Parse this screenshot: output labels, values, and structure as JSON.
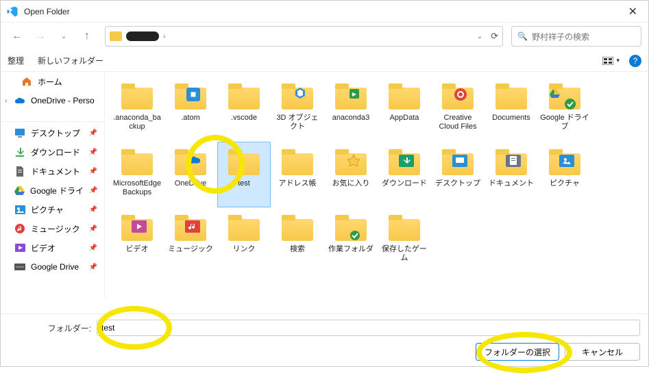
{
  "window": {
    "title": "Open Folder"
  },
  "search": {
    "placeholder": "野村祥子の検索"
  },
  "toolbar": {
    "organize": "整理",
    "new_folder": "新しいフォルダー"
  },
  "sidebar": {
    "home": "ホーム",
    "onedrive": "OneDrive - Perso",
    "quick": [
      {
        "label": "デスクトップ"
      },
      {
        "label": "ダウンロード"
      },
      {
        "label": "ドキュメント"
      },
      {
        "label": "Google ドライ"
      },
      {
        "label": "ピクチャ"
      },
      {
        "label": "ミュージック"
      },
      {
        "label": "ビデオ"
      },
      {
        "label": "Google Drive"
      }
    ]
  },
  "items": [
    {
      "label": ".anaconda_backup"
    },
    {
      "label": ".atom"
    },
    {
      "label": ".vscode"
    },
    {
      "label": "3D オブジェクト"
    },
    {
      "label": "anaconda3"
    },
    {
      "label": "AppData"
    },
    {
      "label": "Creative Cloud Files"
    },
    {
      "label": "Documents"
    },
    {
      "label": "Google ドライブ"
    },
    {
      "label": "MicrosoftEdgeBackups"
    },
    {
      "label": "OneDrive"
    },
    {
      "label": "test"
    },
    {
      "label": "アドレス帳"
    },
    {
      "label": "お気に入り"
    },
    {
      "label": "ダウンロード"
    },
    {
      "label": "デスクトップ"
    },
    {
      "label": "ドキュメント"
    },
    {
      "label": "ピクチャ"
    },
    {
      "label": "ビデオ"
    },
    {
      "label": "ミュージック"
    },
    {
      "label": "リンク"
    },
    {
      "label": "検索"
    },
    {
      "label": "作業フォルダ"
    },
    {
      "label": "保存したゲーム"
    }
  ],
  "footer": {
    "label": "フォルダー:",
    "value": "test",
    "select": "フォルダーの選択",
    "cancel": "キャンセル"
  }
}
